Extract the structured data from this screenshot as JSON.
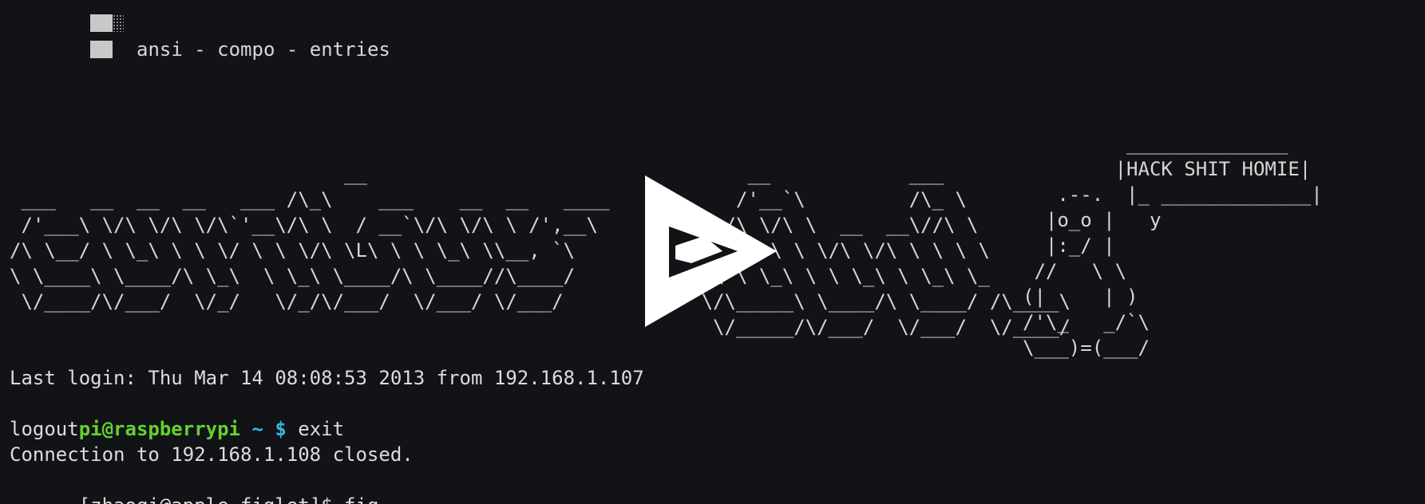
{
  "header": {
    "title": "ansi - compo - entries"
  },
  "ascii_art": {
    "left": "                             __\n ___   __  __  __   ___ /\\_\\    ___    __  __   ____\n /'___\\ \\/\\ \\/\\ \\/\\`'__\\/\\ \\  / __`\\/\\ \\/\\ \\ /',__\\\n/\\ \\__/ \\ \\_\\ \\ \\ \\/ \\ \\ \\/\\ \\L\\ \\ \\ \\_\\ \\\\__, `\\\n\\ \\____\\ \\____/\\ \\_\\  \\ \\_\\ \\____/\\ \\____//\\____/\n \\/____/\\/___/  \\/_/   \\/_/\\/___/  \\/___/ \\/___/",
    "middle": "            __            ___\n           /'__`\\         /\\_ \\\n          /\\ \\/\\ \\  __  __\\//\\ \\\n         /\\ \\ \\ \\ \\/\\ \\/\\ \\ \\ \\ \\\n        /\\ \\ \\_\\ \\ \\ \\_\\ \\ \\_\\ \\_\n        \\/\\_____\\ \\____/\\ \\____/ /\\____\\\n         \\/_____/\\/___/  \\/___/  \\/____/",
    "penguin": "         ______________\n        |HACK SHIT HOMIE|\n   .--.  |_ _____________|\n  |o_o |   y\n  |:_/ |\n //   \\ \\\n(|     | )\n/'\\_   _/`\\\n\\___)=(___/"
  },
  "terminal": {
    "last_login": "Last login: Thu Mar 14 08:08:53 2013 from 192.168.1.107",
    "prompt_user": "pi@raspberrypi",
    "prompt_path": "~",
    "prompt_symbol": "$",
    "command": "exit",
    "logout": "logout",
    "connection_closed": "Connection to 192.168.1.108 closed.",
    "local_prompt": "[zhaoqi@apple figlet]$",
    "typed": "fig"
  },
  "colors": {
    "background": "#121316",
    "text": "#d8d8d8",
    "prompt_user": "#63d22f",
    "prompt_accent": "#35b7e5",
    "play_icon": "#ffffff"
  },
  "icons": {
    "play": "play-icon",
    "block": "block-glyph-icon"
  }
}
